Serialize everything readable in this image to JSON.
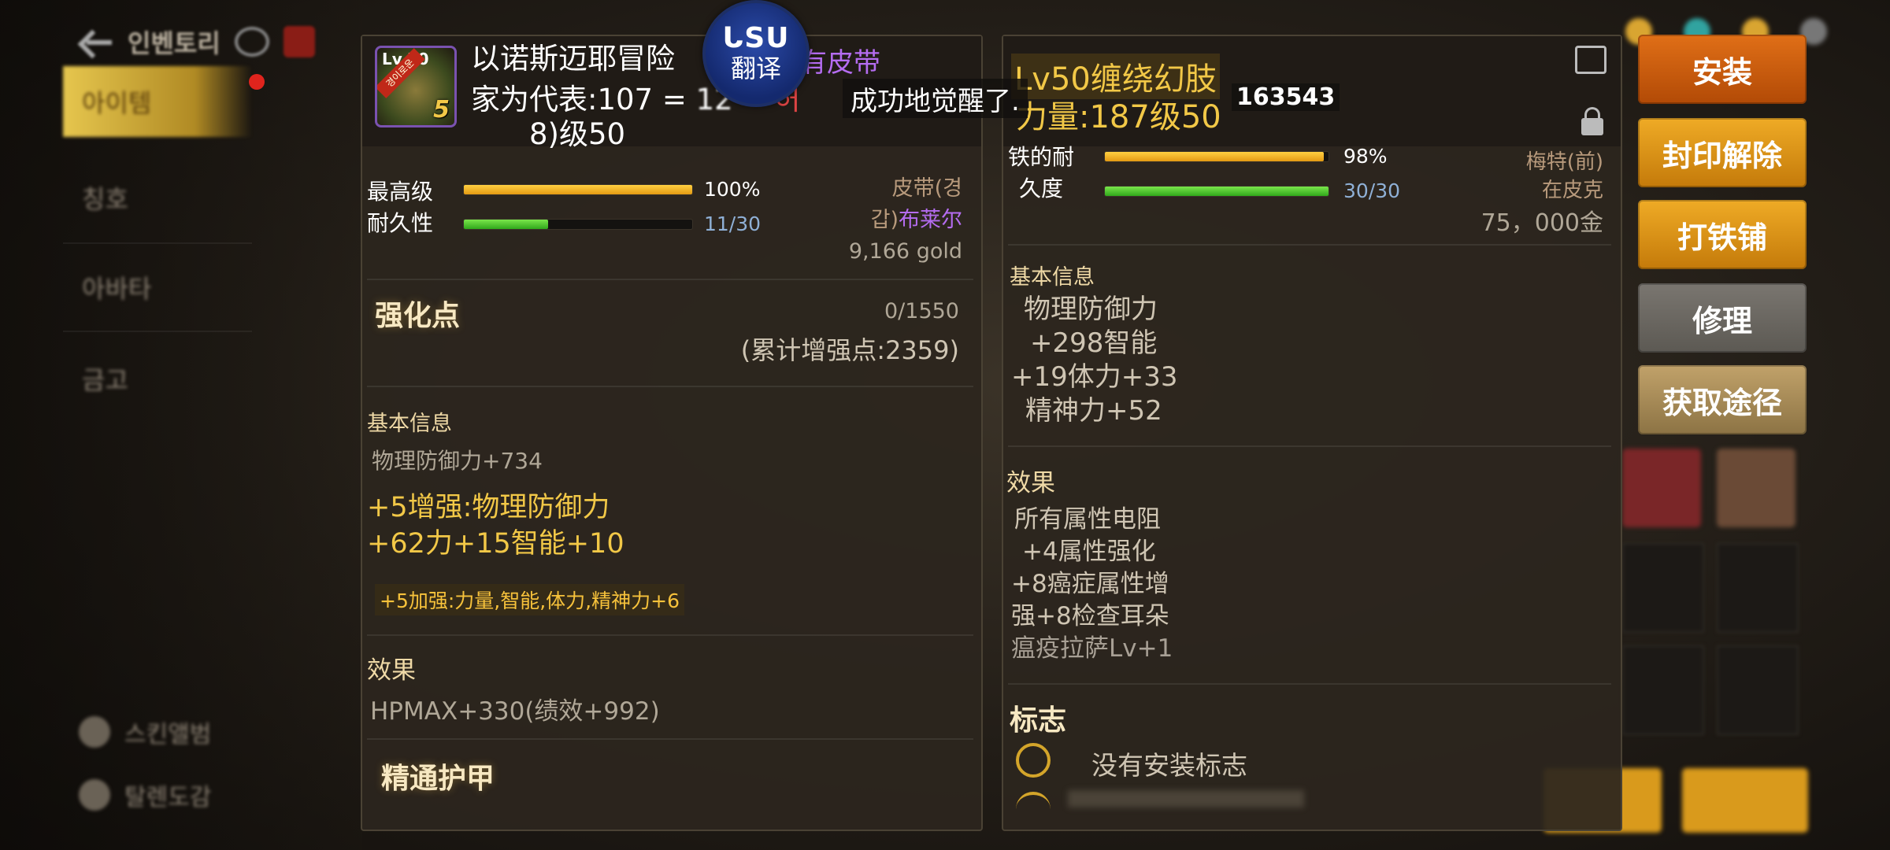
{
  "topnav": {
    "title": "인벤토리"
  },
  "sidebar": {
    "tabs": [
      {
        "label": "아이템",
        "active": true
      },
      {
        "label": "칭호",
        "active": false
      },
      {
        "label": "아바타",
        "active": false
      },
      {
        "label": "금고",
        "active": false
      }
    ],
    "bottom": [
      {
        "label": "스킨앨범"
      },
      {
        "label": "탈렌도감"
      }
    ]
  },
  "translator": {
    "logo": "ᒐSU",
    "label": "翻译"
  },
  "toast": {
    "text": "成功地觉醒了."
  },
  "left_panel": {
    "icon": {
      "level": "Lv.50",
      "ribbon": "경이로운",
      "stars": "5"
    },
    "title_line1": "以诺斯迈耶冒险",
    "title_tag": "有皮带",
    "title_line2": "家为代表:107 =",
    "title_line2_hidden": "12",
    "title_line2_tail": "허",
    "title_line3": "8)级50",
    "durability": {
      "label1": "最高级",
      "label2": "耐久性",
      "top_value": "100%",
      "bottom_value": "11/30",
      "top_fill": 1.0,
      "bottom_fill": 0.37
    },
    "meta": {
      "type1": "皮带(경",
      "type2a": "갑)",
      "type2b": "布莱尔",
      "price": "9,166 gold"
    },
    "enhance": {
      "label": "强化点",
      "value": "0/1550",
      "total": "(累计增强点:2359)"
    },
    "basic_info": {
      "header": "基本信息",
      "base": "物理防御力+734",
      "bonus_line1": "+5增强:物理防御力",
      "bonus_line2": "+62力+15智能+10",
      "bonus_small": "+5加强:力量,智能,体力,精神力+6"
    },
    "effect": {
      "header": "效果",
      "text": "HPMAX+330(绩效+992)"
    },
    "mastery": {
      "label": "精通护甲"
    }
  },
  "right_panel": {
    "title_line1": "Lv50缠绕幻肢",
    "title_line2": "力量:187级50",
    "extra_number": "163543",
    "durability": {
      "label1": "铁的耐",
      "label2": "久度",
      "top_value": "98%",
      "bottom_value": "30/30",
      "top_fill": 0.98,
      "bottom_fill": 1.0
    },
    "meta": {
      "line1": "梅特(前)",
      "line2": "在皮克",
      "price": "75，000金"
    },
    "basic_info": {
      "header": "基本信息",
      "lines": [
        "物理防御力",
        "+298智能",
        "+19体力+33",
        "精神力+52"
      ]
    },
    "effect": {
      "header": "效果",
      "lines": [
        "所有属性电阻",
        "+4属性强化",
        "+8癌症属性增",
        "强+8检查耳朵",
        "瘟疫拉萨Lv+1"
      ]
    },
    "emblem": {
      "header": "标志",
      "none": "没有安装标志"
    }
  },
  "buttons": {
    "install": "安装",
    "unseal": "封印解除",
    "smith": "打铁铺",
    "repair": "修理",
    "source": "获取途径"
  },
  "colors": {
    "accent_gold": "#f2c847",
    "purple": "#b46cf0",
    "orange_bar": "#ffc32a",
    "green_bar": "#49c426"
  }
}
